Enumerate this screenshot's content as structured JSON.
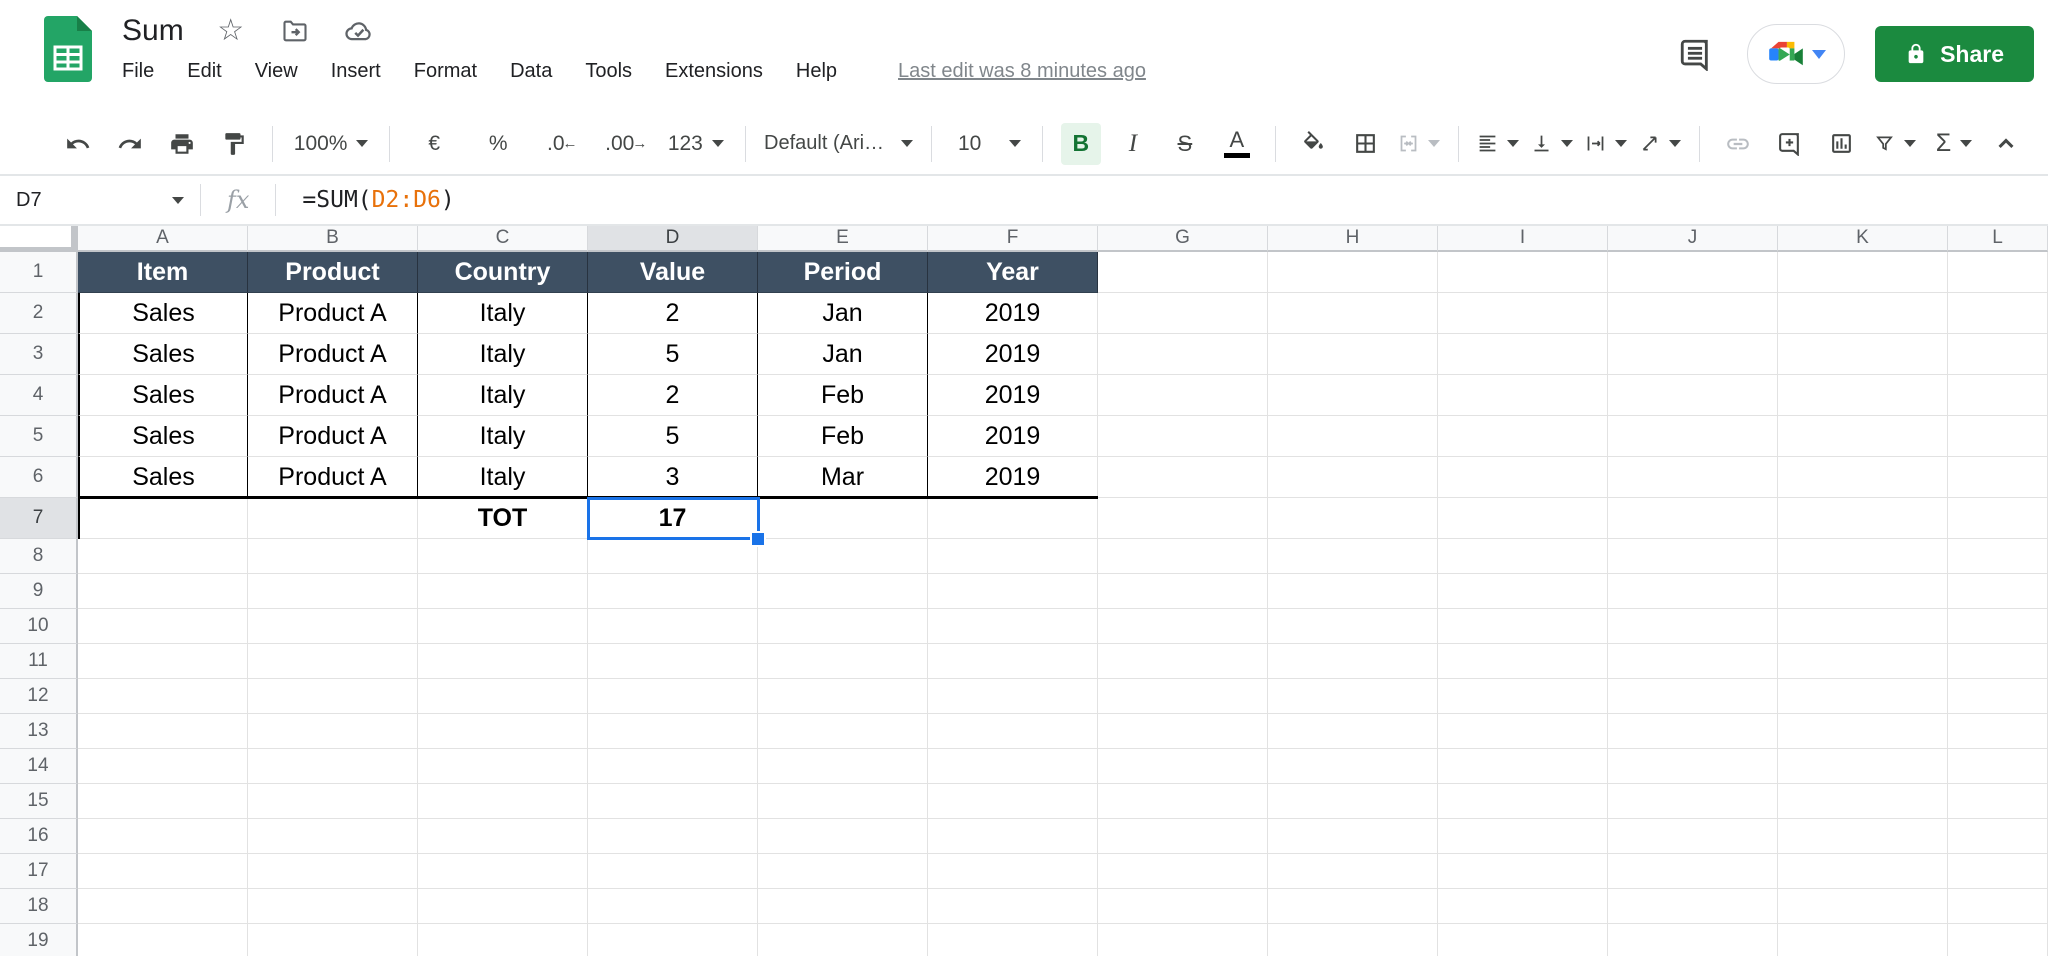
{
  "titlebar": {
    "title": "Sum",
    "menus": [
      "File",
      "Edit",
      "View",
      "Insert",
      "Format",
      "Data",
      "Tools",
      "Extensions",
      "Help"
    ],
    "last_edit": "Last edit was 8 minutes ago",
    "share_label": "Share"
  },
  "toolbar": {
    "zoom_level": "100%",
    "currency": "€",
    "percent": "%",
    "decrease_decimal": ".0",
    "decrease_decimal_arrow": "←",
    "increase_decimal": ".00",
    "increase_decimal_arrow": "→",
    "more_formats": "123",
    "font_name": "Default (Ari…",
    "font_size": "10",
    "bold": "B",
    "italic": "I",
    "strikethrough": "S",
    "text_color": "A",
    "functions": "Σ"
  },
  "formula_bar": {
    "name_box": "D7",
    "fx_label": "fx",
    "formula_prefix": "=SUM(",
    "formula_range": "D2:D6",
    "formula_suffix": ")"
  },
  "grid": {
    "column_letters": [
      "A",
      "B",
      "C",
      "D",
      "E",
      "F",
      "G",
      "H",
      "I",
      "J",
      "K",
      "L"
    ],
    "visible_rows": 19,
    "selected_cell": "D7",
    "selected_column": "D",
    "selected_row": 7,
    "table": {
      "header": [
        "Item",
        "Product",
        "Country",
        "Value",
        "Period",
        "Year"
      ],
      "rows": [
        [
          "Sales",
          "Product A",
          "Italy",
          "2",
          "Jan",
          "2019"
        ],
        [
          "Sales",
          "Product A",
          "Italy",
          "5",
          "Jan",
          "2019"
        ],
        [
          "Sales",
          "Product A",
          "Italy",
          "2",
          "Feb",
          "2019"
        ],
        [
          "Sales",
          "Product A",
          "Italy",
          "5",
          "Feb",
          "2019"
        ],
        [
          "Sales",
          "Product A",
          "Italy",
          "3",
          "Mar",
          "2019"
        ]
      ],
      "total_label": "TOT",
      "total_value": "17"
    },
    "colors": {
      "table_header_bg": "#3e5063",
      "table_header_text": "#ffffff",
      "selection_blue": "#1a73e8",
      "formula_range_orange": "#e8710a",
      "share_green": "#1b8a3f",
      "logo_green": "#23a566"
    }
  }
}
